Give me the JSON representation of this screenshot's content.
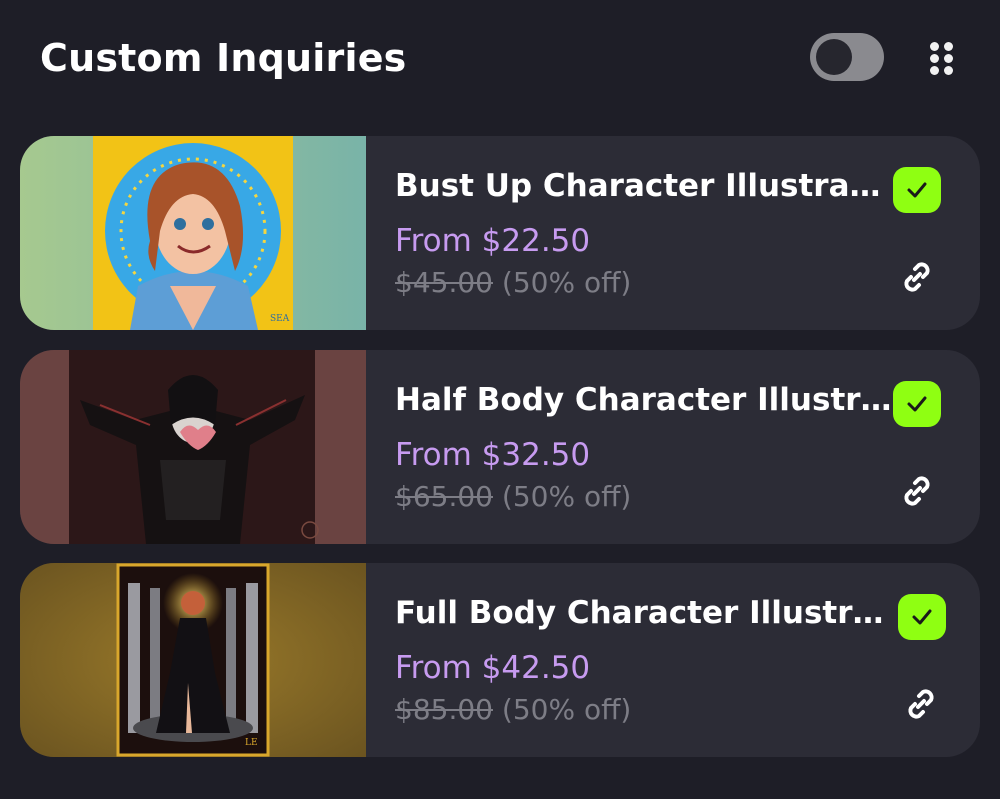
{
  "header": {
    "title": "Custom Inquiries",
    "toggle_icon": "toggle-off",
    "menu_icon": "grid-dots-icon"
  },
  "colors": {
    "background": "#1e1e27",
    "card": "#2c2c36",
    "price_accent": "#c79bf0",
    "muted_text": "#7d7d86",
    "check_badge": "#8fff12"
  },
  "items": [
    {
      "title": "Bust Up Character Illustration",
      "price_label": "From $22.50",
      "original_price": "$45.00",
      "discount": "(50% off)",
      "selected": true,
      "check_icon": "check-icon",
      "link_icon": "link-icon"
    },
    {
      "title": "Half Body Character Illustrati...",
      "price_label": "From $32.50",
      "original_price": "$65.00",
      "discount": "(50% off)",
      "selected": true,
      "check_icon": "check-icon",
      "link_icon": "link-icon"
    },
    {
      "title": "Full Body Character Illustratio...",
      "price_label": "From $42.50",
      "original_price": "$85.00",
      "discount": "(50% off)",
      "selected": true,
      "check_icon": "check-icon",
      "link_icon": "link-icon"
    }
  ]
}
